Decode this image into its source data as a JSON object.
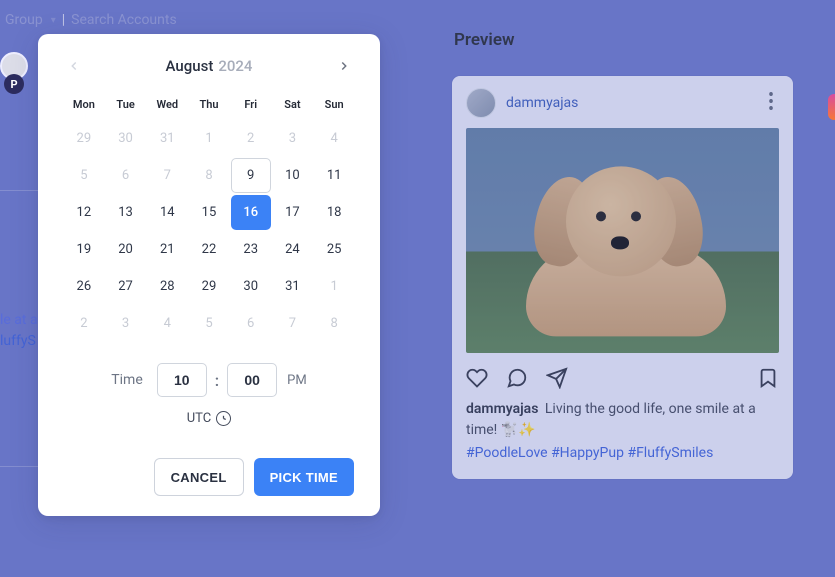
{
  "background": {
    "group_label": "Group",
    "search_placeholder": "Search Accounts",
    "scrap1": "le at a",
    "scrap2": "luffyS"
  },
  "calendar": {
    "month": "August",
    "year": "2024",
    "weekdays": [
      "Mon",
      "Tue",
      "Wed",
      "Thu",
      "Fri",
      "Sat",
      "Sun"
    ],
    "cells": [
      {
        "n": "29",
        "other": true
      },
      {
        "n": "30",
        "other": true
      },
      {
        "n": "31",
        "other": true
      },
      {
        "n": "1",
        "other": true
      },
      {
        "n": "2",
        "other": true
      },
      {
        "n": "3",
        "other": true
      },
      {
        "n": "4",
        "other": true
      },
      {
        "n": "5",
        "other": true
      },
      {
        "n": "6",
        "other": true
      },
      {
        "n": "7",
        "other": true
      },
      {
        "n": "8",
        "other": true
      },
      {
        "n": "9",
        "today": true
      },
      {
        "n": "10"
      },
      {
        "n": "11"
      },
      {
        "n": "12"
      },
      {
        "n": "13"
      },
      {
        "n": "14"
      },
      {
        "n": "15"
      },
      {
        "n": "16",
        "selected": true
      },
      {
        "n": "17"
      },
      {
        "n": "18"
      },
      {
        "n": "19"
      },
      {
        "n": "20"
      },
      {
        "n": "21"
      },
      {
        "n": "22"
      },
      {
        "n": "23"
      },
      {
        "n": "24"
      },
      {
        "n": "25"
      },
      {
        "n": "26"
      },
      {
        "n": "27"
      },
      {
        "n": "28"
      },
      {
        "n": "29"
      },
      {
        "n": "30"
      },
      {
        "n": "31"
      },
      {
        "n": "1",
        "other": true
      },
      {
        "n": "2",
        "other": true
      },
      {
        "n": "3",
        "other": true
      },
      {
        "n": "4",
        "other": true
      },
      {
        "n": "5",
        "other": true
      },
      {
        "n": "6",
        "other": true
      },
      {
        "n": "7",
        "other": true
      },
      {
        "n": "8",
        "other": true
      }
    ],
    "time_label": "Time",
    "hour": "10",
    "minute": "00",
    "meridiem": "PM",
    "timezone": "UTC",
    "buttons": {
      "cancel": "CANCEL",
      "pick": "PICK TIME"
    }
  },
  "preview": {
    "title": "Preview",
    "username": "dammyajas",
    "caption_author": "dammyajas",
    "caption_text": "Living the good life, one smile at a time! 🐩✨",
    "hashtags": "#PoodleLove #HappyPup #FluffySmiles"
  }
}
